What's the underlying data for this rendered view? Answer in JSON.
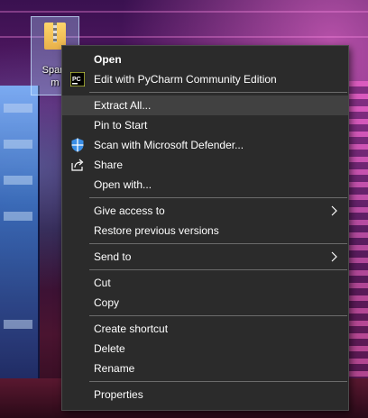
{
  "desktop": {
    "icon_label_line1": "Sparx",
    "icon_label_line2": "m"
  },
  "menu": {
    "open": "Open",
    "edit_pycharm": "Edit with PyCharm Community Edition",
    "pycharm_icon_text": "PC",
    "extract_all": "Extract All...",
    "pin_to_start": "Pin to Start",
    "scan_defender": "Scan with Microsoft Defender...",
    "share": "Share",
    "open_with": "Open with...",
    "give_access": "Give access to",
    "restore_versions": "Restore previous versions",
    "send_to": "Send to",
    "cut": "Cut",
    "copy": "Copy",
    "create_shortcut": "Create shortcut",
    "delete": "Delete",
    "rename": "Rename",
    "properties": "Properties"
  },
  "colors": {
    "menu_bg": "#2b2b2b",
    "hover_bg": "#414141",
    "separator": "#6b6b6b",
    "defender_blue": "#3a8ee6"
  }
}
